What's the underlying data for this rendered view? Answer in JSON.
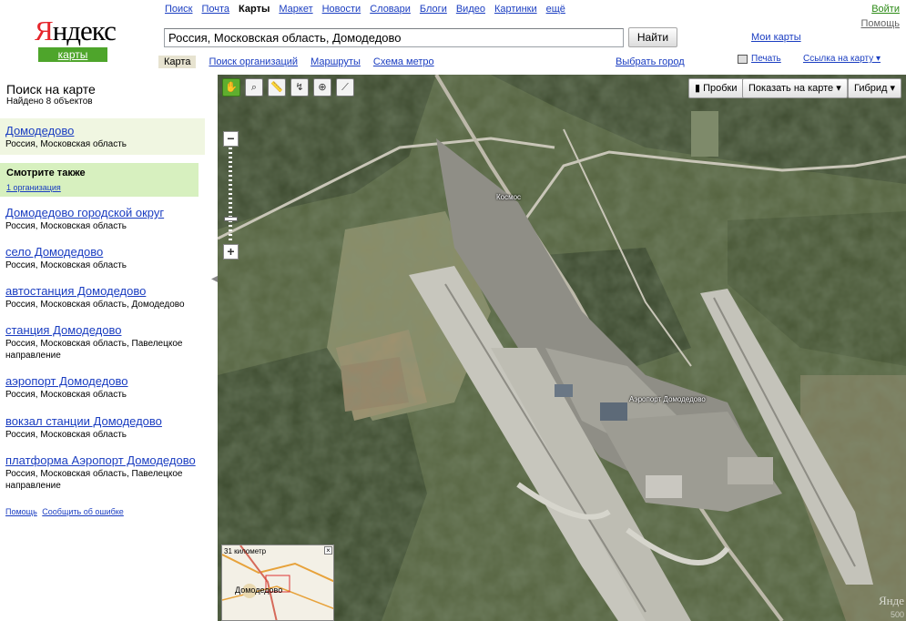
{
  "header": {
    "logo_text_red": "Я",
    "logo_text": "ндекс",
    "logo_sub": "карты",
    "services": [
      "Поиск",
      "Почта",
      "Карты",
      "Маркет",
      "Новости",
      "Словари",
      "Блоги",
      "Видео",
      "Картинки",
      "ещё"
    ],
    "current_service": "Карты",
    "login": "Войти",
    "help": "Помощь",
    "search_value": "Россия, Московская область, Домодедово",
    "search_button": "Найти",
    "my_maps": "Мои карты",
    "tabs": [
      "Карта",
      "Поиск организаций",
      "Маршруты",
      "Схема метро"
    ],
    "region": "Выбрать город",
    "print": "Печать",
    "map_link": "Ссылка на карту ▾"
  },
  "sidebar": {
    "title": "Поиск на карте",
    "count": "Найдено 8 объектов",
    "see_also_title": "Смотрите также",
    "see_also_link": "1 организация",
    "results": [
      {
        "name": "Домодедово",
        "address": "Россия, Московская область"
      },
      {
        "name": "Домодедово городской округ",
        "address": "Россия, Московская область"
      },
      {
        "name": "село Домодедово",
        "address": "Россия, Московская область"
      },
      {
        "name": "автостанция Домодедово",
        "address": "Россия, Московская область, Домодедово"
      },
      {
        "name": "станция Домодедово",
        "address": "Россия, Московская область, Павелецкое направление"
      },
      {
        "name": "аэропорт Домодедово",
        "address": "Россия, Московская область"
      },
      {
        "name": "вокзал станции Домодедово",
        "address": "Россия, Московская область"
      },
      {
        "name": "платформа Аэропорт Домодедово",
        "address": "Россия, Московская область, Павелецкое направление"
      }
    ],
    "footer_links": [
      "Помощь",
      "Сообщить об ошибке"
    ]
  },
  "map": {
    "tools": [
      "hand-icon",
      "zoom-area-icon",
      "ruler-icon",
      "route-icon",
      "placemark-icon",
      "polyline-icon"
    ],
    "traffic": "Пробки",
    "show_on_map": "Показать на карте",
    "layer": "Гибрид",
    "labels": {
      "kosmos": "Космос",
      "airport": "Аэропорт Домодедово"
    },
    "minimap_km": "31 километр",
    "minimap_town": "Домодедово",
    "watermark": "Янде",
    "watermark2": "500"
  }
}
